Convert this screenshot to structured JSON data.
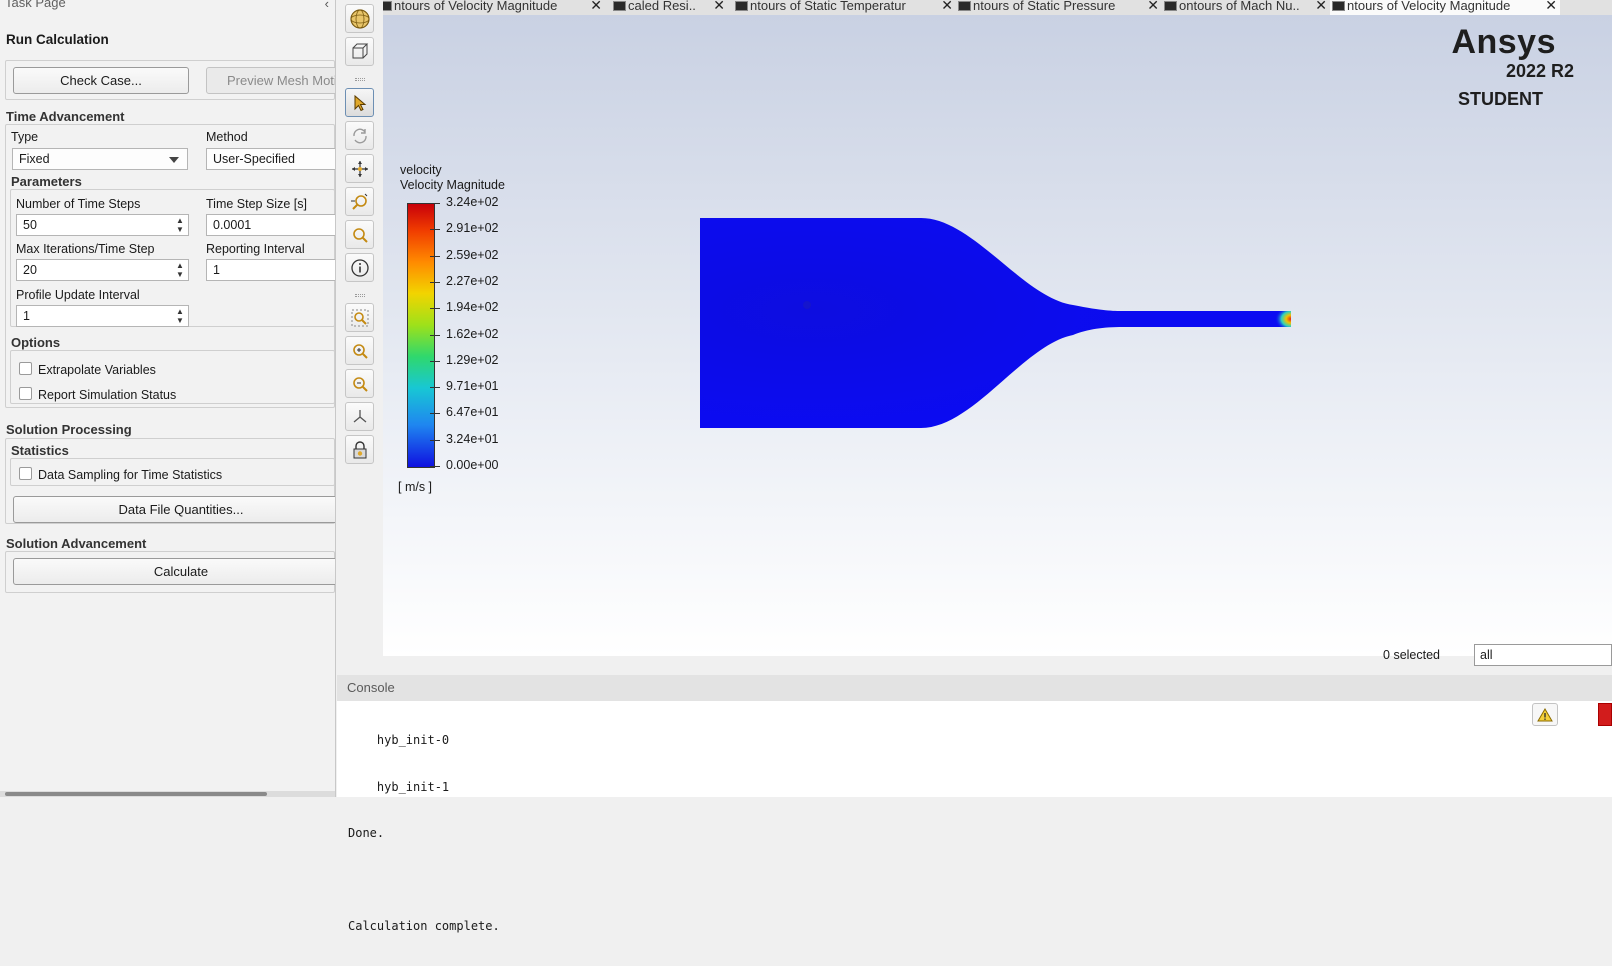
{
  "task_page": {
    "header": "Task Page",
    "title": "Run Calculation",
    "check_case_label": "Check Case...",
    "preview_mesh_label": "Preview Mesh Moti",
    "time_advancement": {
      "heading": "Time Advancement",
      "type_label": "Type",
      "type_value": "Fixed",
      "method_label": "Method",
      "method_value": "User-Specified"
    },
    "parameters": {
      "heading": "Parameters",
      "num_steps_label": "Number of Time Steps",
      "num_steps_value": "50",
      "step_size_label": "Time Step Size [s]",
      "step_size_value": "0.0001",
      "max_iter_label": "Max Iterations/Time Step",
      "max_iter_value": "20",
      "reporting_label": "Reporting Interval",
      "reporting_value": "1",
      "profile_label": "Profile Update Interval",
      "profile_value": "1"
    },
    "options": {
      "heading": "Options",
      "extrapolate_label": "Extrapolate Variables",
      "report_status_label": "Report Simulation Status"
    },
    "solution_processing": {
      "heading": "Solution Processing",
      "statistics_heading": "Statistics",
      "data_sampling_label": "Data Sampling for Time Statistics",
      "data_file_label": "Data File Quantities..."
    },
    "solution_advancement": {
      "heading": "Solution Advancement",
      "calculate_label": "Calculate"
    }
  },
  "tabs": [
    {
      "label": "ntours of Velocity Magnitude",
      "active": false
    },
    {
      "label": "caled Resi..",
      "active": false
    },
    {
      "label": "ntours of Static Temperatur",
      "active": false
    },
    {
      "label": "ntours of Static Pressure",
      "active": false
    },
    {
      "label": "ontours of Mach Nu..",
      "active": false
    },
    {
      "label": "ntours of Velocity Magnitude",
      "active": true
    }
  ],
  "toolbar_icons": [
    "sphere-icon",
    "cube-view-icon",
    "pointer-icon",
    "rotate-icon",
    "pan-icon",
    "zoom-icon",
    "magnify-icon",
    "info-icon",
    "zoom-fit-icon",
    "zoom-in-icon",
    "zoom-out-icon",
    "axes-icon",
    "lock-icon"
  ],
  "graphics": {
    "brand": "Ansys",
    "version": "2022 R2",
    "edition": "STUDENT",
    "legend": {
      "title1": "velocity",
      "title2": "Velocity Magnitude",
      "unit": "[ m/s ]",
      "values": [
        "3.24e+02",
        "2.91e+02",
        "2.59e+02",
        "2.27e+02",
        "1.94e+02",
        "1.62e+02",
        "1.29e+02",
        "9.71e+01",
        "6.47e+01",
        "3.24e+01",
        "0.00e+00"
      ]
    },
    "colors": {
      "nozzle_fill": "#0b0bf2",
      "outlet_hot": "#e0201a"
    },
    "selection_count": "0 selected",
    "selection_filter": "all"
  },
  "console": {
    "heading": "Console",
    "lines": [
      "    hyb_init-0",
      "    hyb_init-1",
      "Done.",
      "",
      "Calculation complete."
    ]
  }
}
